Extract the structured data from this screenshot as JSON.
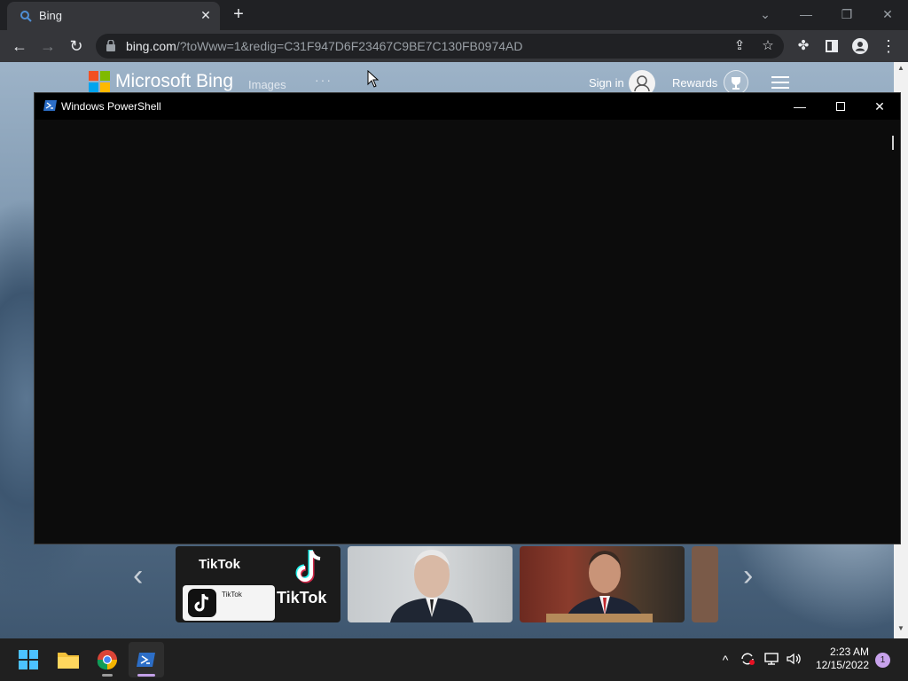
{
  "browser": {
    "tab_title": "Bing",
    "url_domain": "bing.com",
    "url_path": "/?toWww=1&redig=C31F947D6F23467C9BE7C130FB0974AD",
    "tab_close": "✕",
    "new_tab": "+"
  },
  "bing": {
    "brand": "Microsoft Bing",
    "nav_images": "Images",
    "nav_more": "···",
    "sign_in": "Sign in",
    "rewards": "Rewards"
  },
  "news_cards": [
    {
      "label_top": "TikTok",
      "label_big": "TikTok",
      "app_name": "TikTok"
    }
  ],
  "powershell": {
    "title": "Windows PowerShell"
  },
  "taskbar": {
    "time": "2:23 AM",
    "date": "12/15/2022",
    "notifications": "1"
  },
  "colors": {
    "ps_background": "#0c0c0c",
    "chrome_toolbar": "#35363a",
    "taskbar": "#202020",
    "ms_red": "#f25022",
    "ms_green": "#7fba00",
    "ms_blue": "#00a4ef",
    "ms_yellow": "#ffb900"
  }
}
